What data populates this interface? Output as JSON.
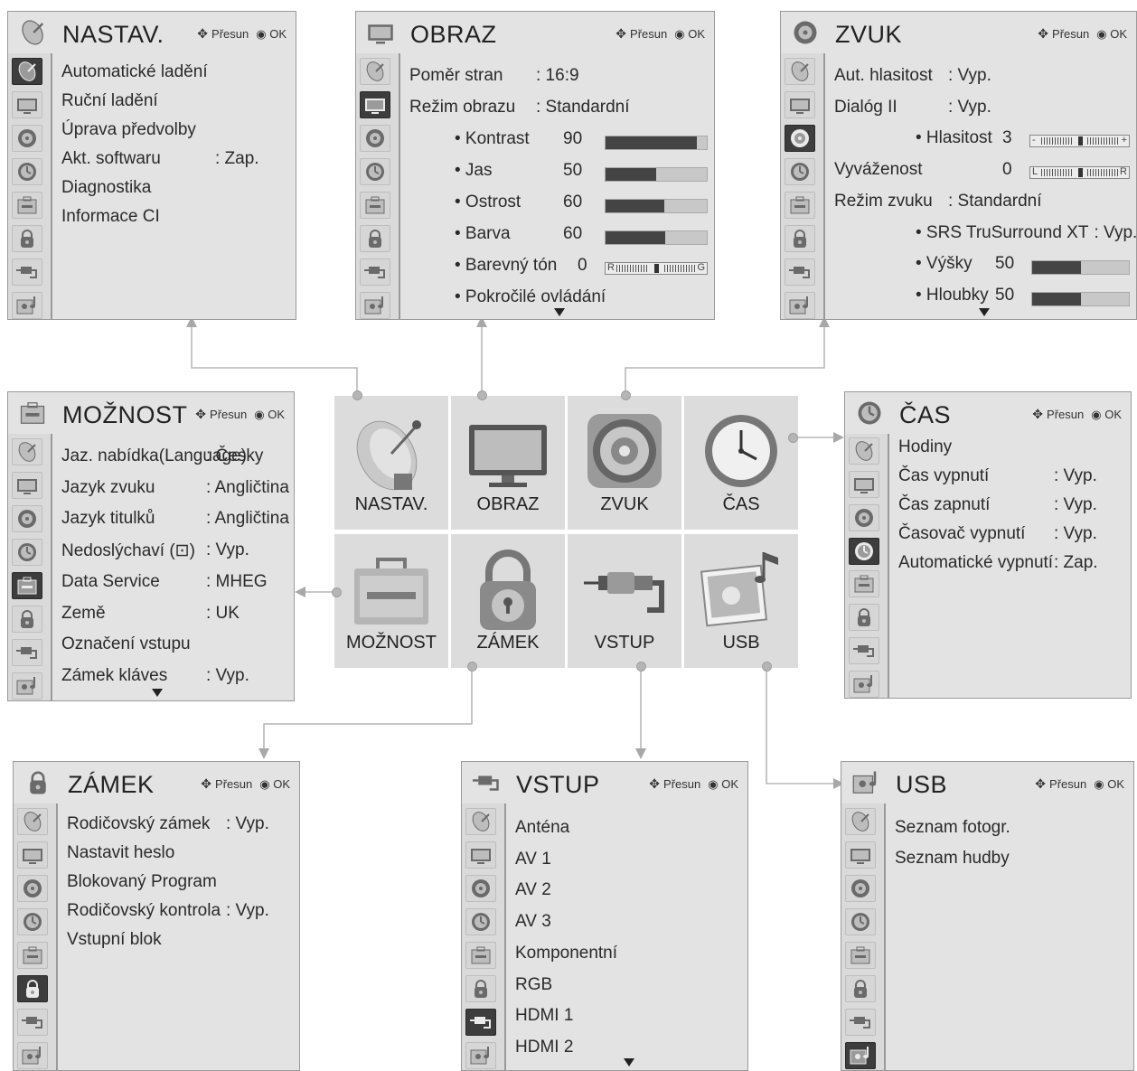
{
  "nav": {
    "move": "Přesun",
    "ok": "OK"
  },
  "tiles": {
    "nastav": "NASTAV.",
    "obraz": "OBRAZ",
    "zvuk": "ZVUK",
    "cas": "ČAS",
    "moznost": "MOŽNOST",
    "zamek": "ZÁMEK",
    "vstup": "VSTUP",
    "usb": "USB"
  },
  "panels": {
    "nastav": {
      "title": "NASTAV.",
      "rows": [
        {
          "label": "Automatické ladění",
          "value": ""
        },
        {
          "label": "Ruční ladění",
          "value": ""
        },
        {
          "label": "Úprava předvolby",
          "value": ""
        },
        {
          "label": "Akt. softwaru",
          "value": ": Zap."
        },
        {
          "label": "Diagnostika",
          "value": ""
        },
        {
          "label": "Informace CI",
          "value": ""
        }
      ]
    },
    "obraz": {
      "title": "OBRAZ",
      "rows": [
        {
          "label": "Poměr stran",
          "value": ": 16:9"
        },
        {
          "label": "Režim obrazu",
          "value": ":  Standardní"
        },
        {
          "label": "• Kontrast",
          "value": "90",
          "level": 0.9
        },
        {
          "label": "• Jas",
          "value": "50",
          "level": 0.5
        },
        {
          "label": "• Ostrost",
          "value": "60",
          "level": 0.58
        },
        {
          "label": "• Barva",
          "value": "60",
          "level": 0.59
        },
        {
          "label": "• Barevný tón",
          "value": "0",
          "left": "R",
          "right": "G"
        },
        {
          "label": "• Pokročilé ovládání",
          "value": ""
        }
      ]
    },
    "zvuk": {
      "title": "ZVUK",
      "rows": [
        {
          "label": "Aut. hlasitost",
          "value": ": Vyp."
        },
        {
          "label": "Dialóg II",
          "value": ": Vyp."
        },
        {
          "label": "• Hlasitost",
          "value": "3",
          "left": "-",
          "right": "+"
        },
        {
          "label": "Vyváženost",
          "value": "0",
          "left": "L",
          "right": "R"
        },
        {
          "label": "Režim zvuku",
          "value": ": Standardní"
        },
        {
          "label": "• SRS TruSurround XT",
          "value": ": Vyp."
        },
        {
          "label": "• Výšky",
          "value": "50",
          "level": 0.5
        },
        {
          "label": "• Hloubky",
          "value": "50",
          "level": 0.5
        }
      ]
    },
    "moznost": {
      "title": "MOŽNOST",
      "rows": [
        {
          "label": "Jaz. nabídka(Language)",
          "value": ": Česky"
        },
        {
          "label": "Jazyk zvuku",
          "value": ": Angličtina"
        },
        {
          "label": "Jazyk titulků",
          "value": ": Angličtina"
        },
        {
          "label": "Nedoslýchaví (⊡)",
          "value": ": Vyp."
        },
        {
          "label": "Data Service",
          "value": ": MHEG"
        },
        {
          "label": "Země",
          "value": ": UK"
        },
        {
          "label": "Označení vstupu",
          "value": ""
        },
        {
          "label": "Zámek kláves",
          "value": ": Vyp."
        }
      ]
    },
    "cas": {
      "title": "ČAS",
      "rows": [
        {
          "label": "Hodiny",
          "value": ""
        },
        {
          "label": "Čas vypnutí",
          "value": ": Vyp."
        },
        {
          "label": "Čas zapnutí",
          "value": ": Vyp."
        },
        {
          "label": "Časovač vypnutí",
          "value": ": Vyp."
        },
        {
          "label": "Automatické vypnutí",
          "value": ": Zap."
        }
      ]
    },
    "zamek": {
      "title": "ZÁMEK",
      "rows": [
        {
          "label": "Rodičovský zámek",
          "value": ": Vyp."
        },
        {
          "label": "Nastavit heslo",
          "value": ""
        },
        {
          "label": "Blokovaný Program",
          "value": ""
        },
        {
          "label": "Rodičovský kontrola",
          "value": ": Vyp."
        },
        {
          "label": "Vstupní blok",
          "value": ""
        }
      ]
    },
    "vstup": {
      "title": "VSTUP",
      "rows": [
        {
          "label": "Anténa",
          "value": ""
        },
        {
          "label": "AV 1",
          "value": ""
        },
        {
          "label": "AV 2",
          "value": ""
        },
        {
          "label": "AV 3",
          "value": ""
        },
        {
          "label": "Komponentní",
          "value": ""
        },
        {
          "label": "RGB",
          "value": ""
        },
        {
          "label": "HDMI 1",
          "value": ""
        },
        {
          "label": "HDMI 2",
          "value": ""
        }
      ]
    },
    "usb": {
      "title": "USB",
      "rows": [
        {
          "label": "Seznam fotogr.",
          "value": ""
        },
        {
          "label": "Seznam hudby",
          "value": ""
        }
      ]
    }
  }
}
